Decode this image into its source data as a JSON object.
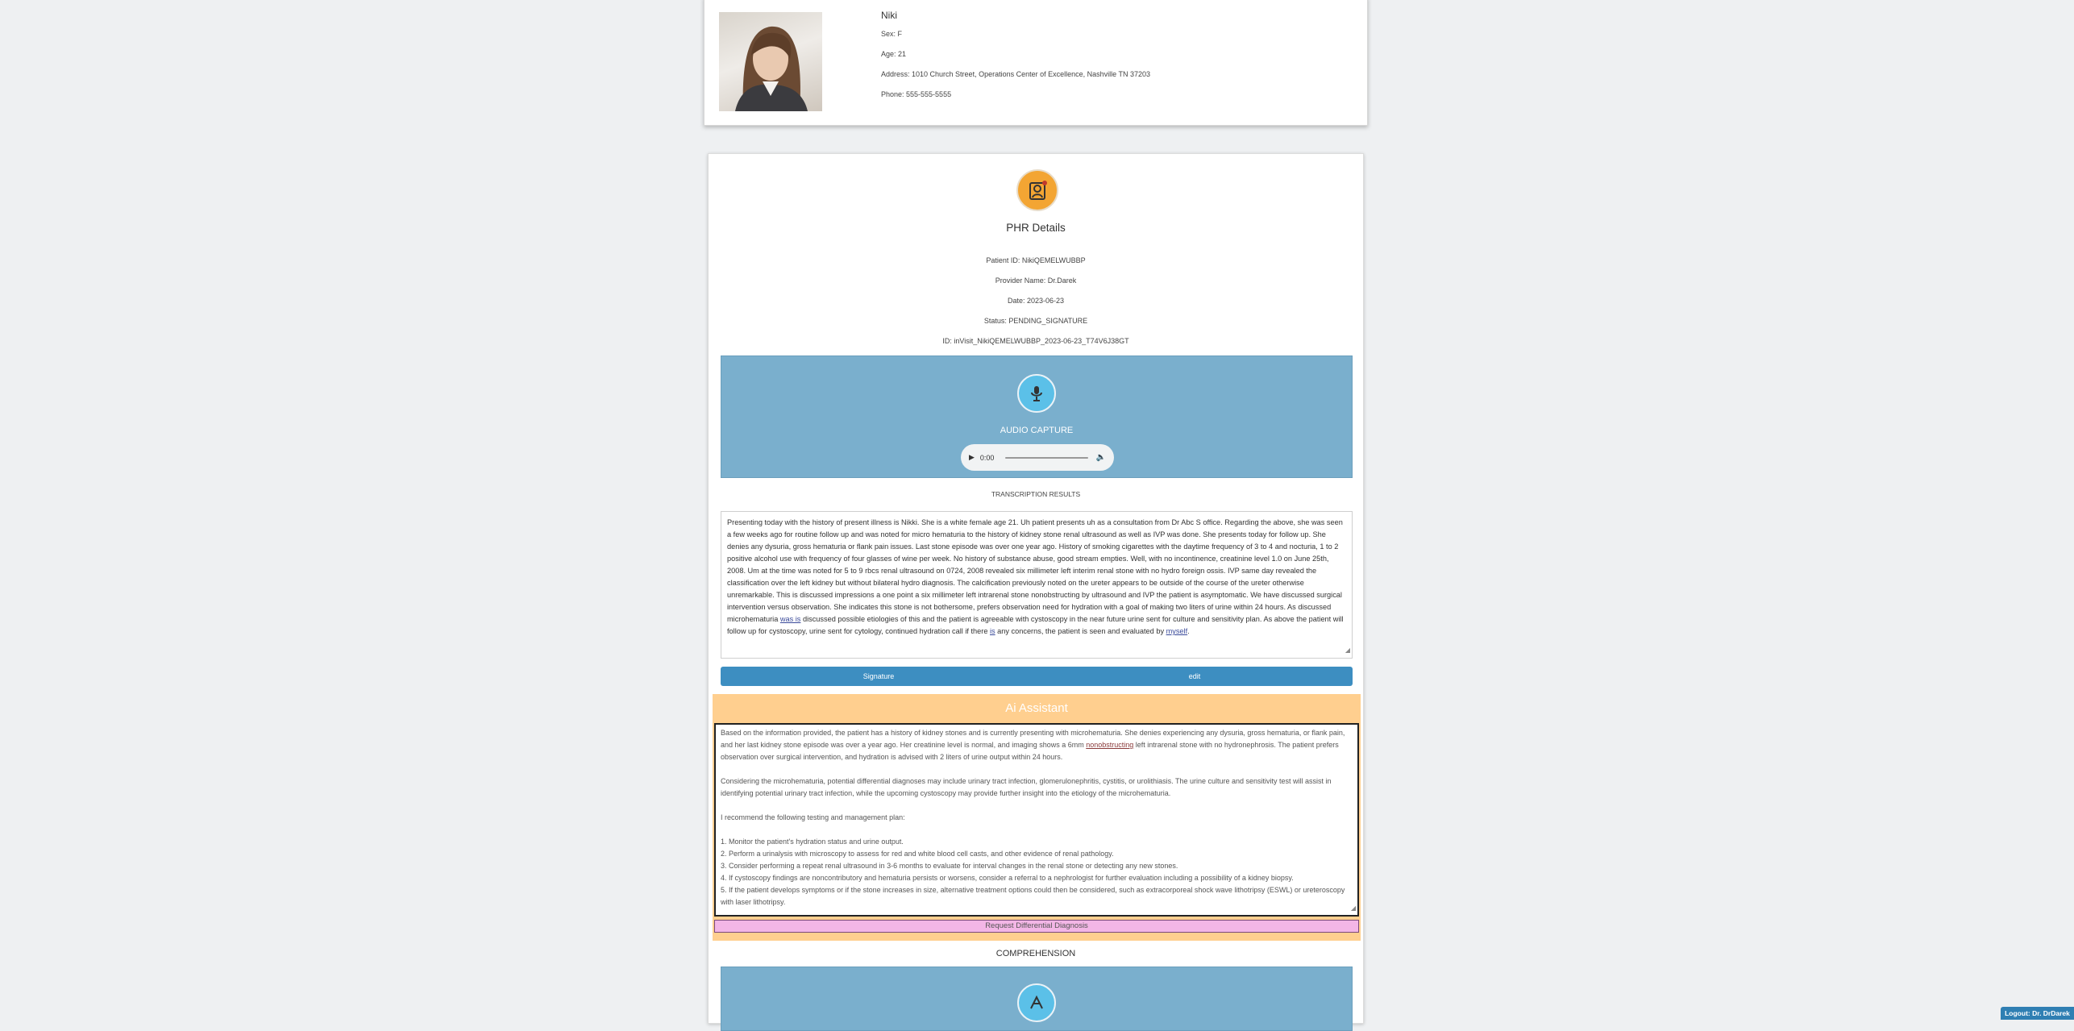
{
  "patient": {
    "name": "Niki",
    "sex": "Sex: F",
    "age": "Age: 21",
    "address": "Address: 1010 Church Street, Operations Center of Excellence, Nashville TN 37203",
    "phone": "Phone: 555-555-5555"
  },
  "phr": {
    "title": "PHR Details",
    "patient_id": "Patient ID: NikiQEMELWUBBP",
    "provider": "Provider Name: Dr.Darek",
    "date": "Date: 2023-06-23",
    "status": "Status: PENDING_SIGNATURE",
    "id": "ID: inVisit_NikiQEMELWUBBP_2023-06-23_T74V6J38GT"
  },
  "audio": {
    "title": "AUDIO CAPTURE",
    "time": "0:00"
  },
  "transcription": {
    "title": "TRANSCRIPTION RESULTS",
    "text_a": "Presenting today with the history of present illness is Nikki. She is a white female age 21. Uh patient presents uh as a consultation from Dr Abc S office. Regarding the above, she was seen a few weeks ago for routine follow up and was noted for micro hematuria to the history of kidney stone renal ultrasound as well as IVP was done. She presents today for follow up. She denies any dysuria, gross hematuria or flank pain issues. Last stone episode was over one year ago. History of smoking cigarettes with the daytime frequency of 3 to 4 and nocturia, 1 to 2 positive alcohol use with frequency of four glasses of wine per week. No history of substance abuse, good stream empties. Well, with no incontinence, creatinine level 1.0 on June 25th, 2008. Um at the time was noted for 5 to 9 rbcs renal ultrasound on 0724, 2008 revealed six millimeter left interim renal stone with no hydro foreign ossis. IVP same day revealed the classification over the left kidney but without bilateral hydro diagnosis. The calcification previously noted on the ureter appears to be outside of the course of the ureter otherwise unremarkable. This is discussed impressions a one point a six millimeter left intrarenal stone nonobstructing by ultrasound and IVP the patient is asymptomatic. We have discussed surgical intervention versus observation. She indicates this stone is not bothersome, prefers observation need for hydration with a goal of making two liters of urine within 24 hours. As discussed microhematuria ",
    "link1": "was is",
    "text_b": " discussed possible etiologies of this and the patient is agreeable with cystoscopy in the near future urine sent for culture and sensitivity plan. As above the patient will follow up for cystoscopy, urine sent for cytology, continued hydration call if there ",
    "link2": "is",
    "text_c": " any concerns, the patient is seen and evaluated by ",
    "link3": "myself",
    "text_d": "."
  },
  "buttons": {
    "signature": "Signature",
    "edit": "edit"
  },
  "ai": {
    "title": "Ai Assistant",
    "p1a": "Based on the information provided, the patient has a history of kidney stones and is currently presenting with microhematuria. She denies experiencing any dysuria, gross hematuria, or flank pain, and her last kidney stone episode was over a year ago. Her creatinine level is normal, and imaging shows a 6mm ",
    "p1link": "nonobstructing",
    "p1b": " left intrarenal stone with no hydronephrosis. The patient prefers observation over surgical intervention, and hydration is advised with 2 liters of urine output within 24 hours.",
    "p2": "Considering the microhematuria, potential differential diagnoses may include urinary tract infection, glomerulonephritis, cystitis, or urolithiasis. The urine culture and sensitivity test will assist in identifying potential urinary tract infection, while the upcoming cystoscopy may provide further insight into the etiology of the microhematuria.",
    "p3": "I recommend the following testing and management plan:",
    "items": [
      "1. Monitor the patient's hydration status and urine output.",
      "2. Perform a urinalysis with microscopy to assess for red and white blood cell casts, and other evidence of renal pathology.",
      "3. Consider performing a repeat renal ultrasound in 3-6 months to evaluate for interval changes in the renal stone or detecting any new stones.",
      "4. If cystoscopy findings are noncontributory and hematuria persists or worsens, consider a referral to a nephrologist for further evaluation including a possibility of a kidney biopsy.",
      "5. If the patient develops symptoms or if the stone increases in size, alternative treatment options could then be considered, such as extracorporeal shock wave lithotripsy (ESWL) or ureteroscopy with laser lithotripsy."
    ],
    "ddx_button": "Request Differential Diagnosis"
  },
  "comprehension": {
    "title": "COMPREHENSION"
  },
  "logout": "Logout: Dr. DrDarek",
  "colors": {
    "panel_blue": "#7aafcd",
    "button_blue": "#3d8ec1",
    "ai_orange": "#ffcf8f",
    "ddx_pink": "#f3b6e6",
    "icon_orange": "#f3a533",
    "icon_blue": "#5bc0e8"
  }
}
